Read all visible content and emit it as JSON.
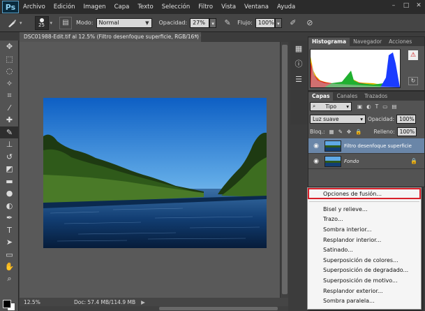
{
  "app": {
    "logo": "Ps"
  },
  "menubar": {
    "items": [
      "Archivo",
      "Edición",
      "Imagen",
      "Capa",
      "Texto",
      "Selección",
      "Filtro",
      "Vista",
      "Ventana",
      "Ayuda"
    ],
    "window_controls": [
      "–",
      "□",
      "✕"
    ]
  },
  "options_bar": {
    "brush_size": "25",
    "mode_label": "Modo:",
    "mode_value": "Normal",
    "opacity_label": "Opacidad:",
    "opacity_value": "27%",
    "flow_label": "Flujo:",
    "flow_value": "100%"
  },
  "document": {
    "tab_title": "DSC01988-Edit.tif al 12.5% (Filtro desenfoque superficie, RGB/16*) *",
    "close": "×"
  },
  "statusbar": {
    "zoom": "12.5%",
    "doc_info": "Doc: 57.4 MB/114.9 MB",
    "arrow": "▶"
  },
  "histogram_panel": {
    "tabs": [
      "Histograma",
      "Navegador",
      "Acciones"
    ],
    "warning": "⚠"
  },
  "layers_panel": {
    "tabs": [
      "Capas",
      "Canales",
      "Trazados"
    ],
    "filter_kind": "Tipo",
    "blend_mode": "Luz suave",
    "opacity_label": "Opacidad:",
    "opacity_value": "100%",
    "lock_label": "Bloq.:",
    "fill_label": "Relleno:",
    "fill_value": "100%",
    "layers": [
      {
        "name": "Filtro desenfoque superficie",
        "selected": true
      },
      {
        "name": "Fondo",
        "selected": false,
        "locked": true
      }
    ]
  },
  "context_menu": {
    "highlighted": "Opciones de fusión...",
    "items": [
      "Bisel y relieve...",
      "Trazo...",
      "Sombra interior...",
      "Resplandor interior...",
      "Satinado...",
      "Superposición de colores...",
      "Superposición de degradado...",
      "Superposición de motivo...",
      "Resplandor exterior...",
      "Sombra paralela..."
    ]
  },
  "colors": {
    "highlight_border": "#d8202a",
    "selected_layer": "#6a86a8"
  }
}
